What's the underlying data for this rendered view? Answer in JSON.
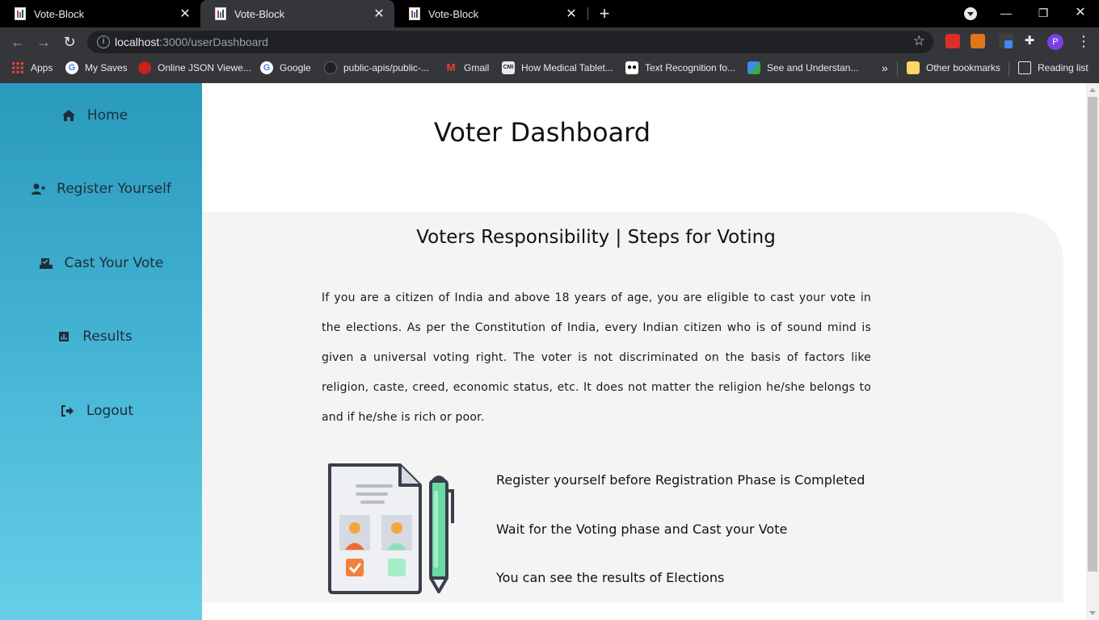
{
  "browser": {
    "tabs": [
      {
        "title": "Vote-Block",
        "active": false
      },
      {
        "title": "Vote-Block",
        "active": true
      },
      {
        "title": "Vote-Block",
        "active": false
      }
    ],
    "url_host": "localhost",
    "url_rest": ":3000/userDashboard",
    "profile_initial": "P",
    "bookmarks": [
      {
        "label": "Apps",
        "icon": "apps-grid-icon"
      },
      {
        "label": "My Saves",
        "icon": "google-icon"
      },
      {
        "label": "Online JSON Viewe...",
        "icon": "json-viewer-icon"
      },
      {
        "label": "Google",
        "icon": "google-icon"
      },
      {
        "label": "public-apis/public-...",
        "icon": "github-icon"
      },
      {
        "label": "Gmail",
        "icon": "gmail-icon"
      },
      {
        "label": "How Medical Tablet...",
        "icon": "cmi-icon"
      },
      {
        "label": "Text Recognition fo...",
        "icon": "medium-icon"
      },
      {
        "label": "See and Understan...",
        "icon": "ml-kit-icon"
      }
    ],
    "overflow_label": "»",
    "other_bookmarks": "Other bookmarks",
    "reading_list": "Reading list"
  },
  "sidebar": {
    "items": [
      {
        "label": "Home",
        "icon": "home-icon"
      },
      {
        "label": "Register Yourself",
        "icon": "user-plus-icon"
      },
      {
        "label": "Cast Your Vote",
        "icon": "vote-box-icon"
      },
      {
        "label": "Results",
        "icon": "chart-icon"
      },
      {
        "label": "Logout",
        "icon": "logout-icon"
      }
    ]
  },
  "main": {
    "title": "Voter Dashboard",
    "panel": {
      "title": "Voters Responsibility | Steps for Voting",
      "paragraph": "If you are a citizen of India and above 18 years of age, you are eligible to cast your vote in the elections. As per the Constitution of India, every Indian citizen who is of sound mind is given a universal voting right. The voter is not discriminated on the basis of factors like religion, caste, creed, economic status, etc. It does not matter the religion he/she belongs to and if he/she is rich or poor.",
      "steps": [
        "Register yourself before Registration Phase is Completed",
        "Wait for the Voting phase and Cast your Vote",
        "You can see the results of Elections"
      ],
      "illustration_icon": "ballot-paper-and-pen-icon"
    }
  },
  "colors": {
    "sidebar_top": "#2999bc",
    "sidebar_bottom": "#66cfe9",
    "panel_bg": "#f4f4f4",
    "chrome_dark": "#35363a"
  }
}
